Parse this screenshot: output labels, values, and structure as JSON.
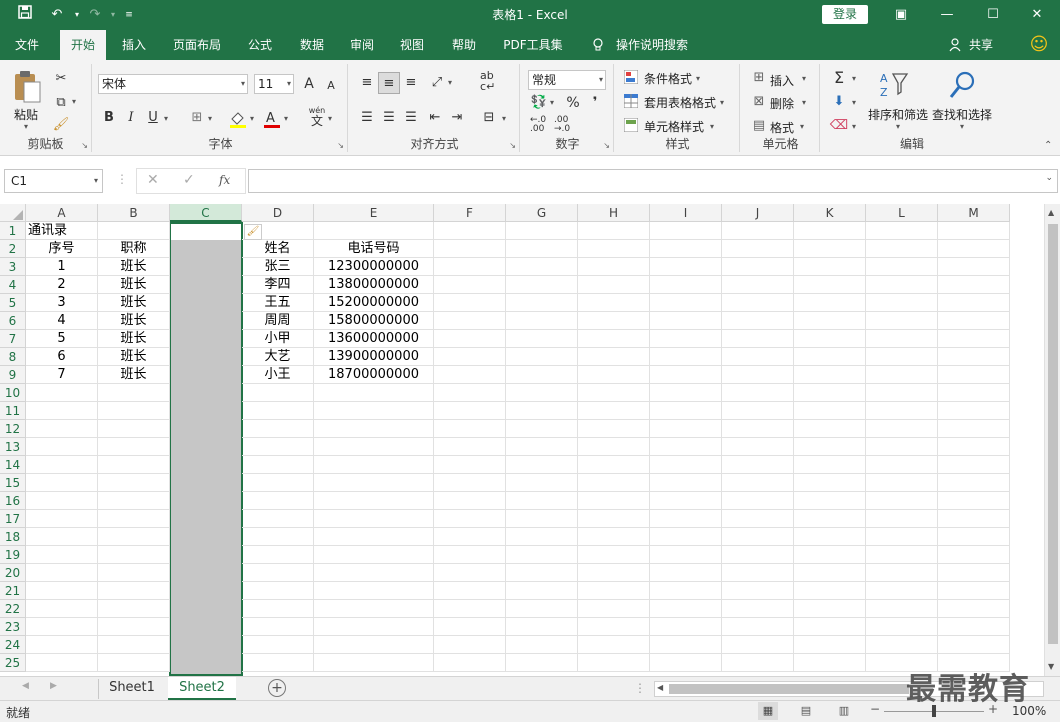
{
  "window": {
    "title": "表格1  -  Excel",
    "login_label": "登录",
    "share_label": "共享",
    "smiley": "☺"
  },
  "tabs": [
    {
      "label": "文件"
    },
    {
      "label": "开始"
    },
    {
      "label": "插入"
    },
    {
      "label": "页面布局"
    },
    {
      "label": "公式"
    },
    {
      "label": "数据"
    },
    {
      "label": "审阅"
    },
    {
      "label": "视图"
    },
    {
      "label": "帮助"
    },
    {
      "label": "PDF工具集"
    },
    {
      "label": "操作说明搜索"
    }
  ],
  "ribbon": {
    "clipboard": {
      "paste": "粘贴",
      "label": "剪贴板"
    },
    "font": {
      "name": "宋体",
      "size": "11",
      "label": "字体",
      "bold": "B",
      "italic": "I",
      "underline": "U",
      "grow": "A",
      "shrink": "A",
      "wen": "wén",
      "wen_char": "文"
    },
    "align": {
      "label": "对齐方式",
      "wrap": "ab",
      "ab2": "c"
    },
    "number": {
      "format": "常规",
      "label": "数字",
      "percent": "%",
      "comma": "❜",
      "dec_inc": "←.0\n.00",
      "dec_dec": ".00\n→.0"
    },
    "styles": {
      "cond": "条件格式",
      "table": "套用表格格式",
      "cell": "单元格样式",
      "label": "样式"
    },
    "cells": {
      "insert": "插入",
      "delete": "删除",
      "format": "格式",
      "label": "单元格"
    },
    "editing": {
      "sort": "排序和筛选",
      "find": "查找和选择",
      "label": "编辑",
      "sigma": "Σ",
      "az": "A↓Z"
    }
  },
  "formula_bar": {
    "name_box": "C1",
    "fx": "fx",
    "value": ""
  },
  "columns": [
    "A",
    "B",
    "C",
    "D",
    "E",
    "F",
    "G",
    "H",
    "I",
    "J",
    "K",
    "L",
    "M"
  ],
  "rows": [
    "1",
    "2",
    "3",
    "4",
    "5",
    "6",
    "7",
    "8",
    "9",
    "10",
    "11",
    "12",
    "13",
    "14",
    "15",
    "16",
    "17",
    "18",
    "19",
    "20",
    "21",
    "22",
    "23",
    "24",
    "25"
  ],
  "cells": {
    "A1": "通讯录",
    "A2": "序号",
    "B2": "职称",
    "D2": "姓名",
    "E2": "电话号码",
    "A3": "1",
    "B3": "班长",
    "D3": "张三",
    "E3": "12300000000",
    "A4": "2",
    "B4": "班长",
    "D4": "李四",
    "E4": "13800000000",
    "A5": "3",
    "B5": "班长",
    "D5": "王五",
    "E5": "15200000000",
    "A6": "4",
    "B6": "班长",
    "D6": "周周",
    "E6": "15800000000",
    "A7": "5",
    "B7": "班长",
    "D7": "小甲",
    "E7": "13600000000",
    "A8": "6",
    "B8": "班长",
    "D8": "大艺",
    "E8": "13900000000",
    "A9": "7",
    "B9": "班长",
    "D9": "小王",
    "E9": "18700000000"
  },
  "sheets": [
    {
      "label": "Sheet1"
    },
    {
      "label": "Sheet2"
    }
  ],
  "status": {
    "ready": "就绪",
    "zoom": "100%"
  },
  "watermark": "最需教育",
  "colors": {
    "accent": "#217346",
    "selected_column": "#c6c6c6"
  }
}
